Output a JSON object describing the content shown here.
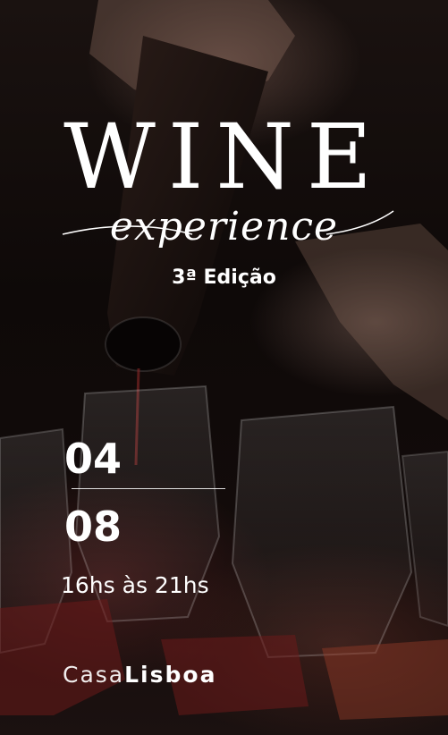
{
  "title": "WINE",
  "subtitle": "experience",
  "edition": "3ª Edição",
  "date": {
    "day": "04",
    "month": "08"
  },
  "hours": "16hs às 21hs",
  "venue": {
    "part1": "Casa",
    "part2": "Lisboa"
  },
  "colors": {
    "text": "#ffffff",
    "background": "#0b0706",
    "wine": "#6b1a1a"
  }
}
